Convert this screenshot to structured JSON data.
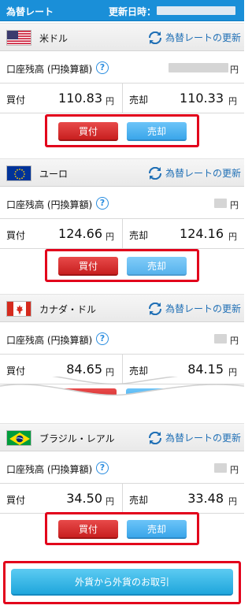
{
  "header": {
    "title": "為替レート",
    "updated_label": "更新日時："
  },
  "refresh_label": "為替レートの更新",
  "balance_label": "口座残高 (円換算額)",
  "help_glyph": "?",
  "yen": "円",
  "buy_label": "買付",
  "sell_label": "売却",
  "currencies": [
    {
      "name": "米ドル",
      "flag": "us-flag-icon",
      "buy_rate": "110.83",
      "sell_rate": "110.33"
    },
    {
      "name": "ユーロ",
      "flag": "eu-flag-icon",
      "buy_rate": "124.66",
      "sell_rate": "124.16"
    },
    {
      "name": "カナダ・ドル",
      "flag": "canada-flag-icon",
      "buy_rate": "84.65",
      "sell_rate": "84.15"
    },
    {
      "name": "ブラジル・レアル",
      "flag": "brazil-flag-icon",
      "buy_rate": "34.50",
      "sell_rate": "33.48"
    }
  ],
  "buy_button": "買付",
  "sell_button": "売却",
  "cta_label": "外貨から外貨のお取引",
  "colors": {
    "header": "#1a8fd8",
    "buy": "#d42a2a",
    "sell": "#4fb4f2",
    "highlight": "#e2001b",
    "link": "#1f6fb5"
  }
}
